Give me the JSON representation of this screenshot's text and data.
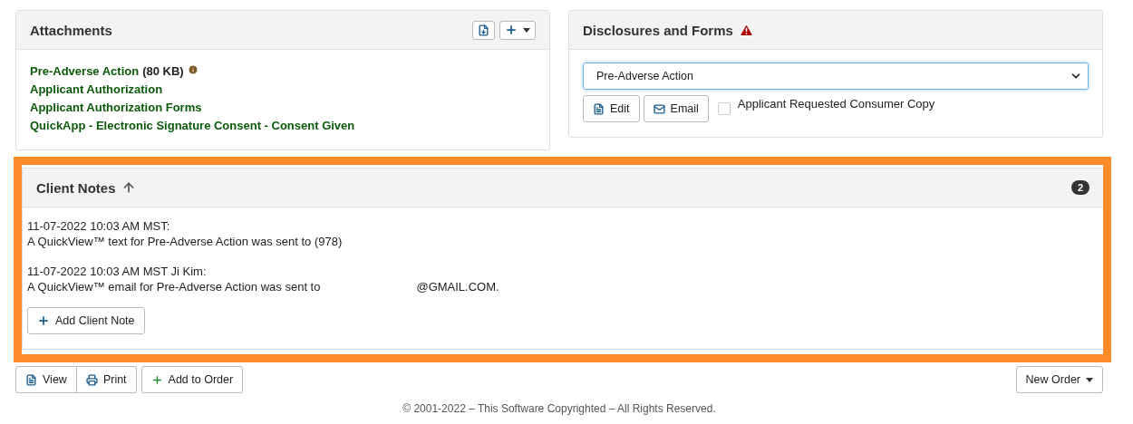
{
  "attachments": {
    "title": "Attachments",
    "items": [
      {
        "label": "Pre-Adverse Action",
        "size": "(80 KB)",
        "info": true
      },
      {
        "label": "Applicant Authorization",
        "info": false
      },
      {
        "label": "Applicant Authorization Forms",
        "info": false
      },
      {
        "label": "QuickApp - Electronic Signature Consent - Consent Given",
        "info": false
      }
    ]
  },
  "disclosures": {
    "title": "Disclosures and Forms",
    "warning": true,
    "select_value": "Pre-Adverse Action",
    "buttons": [
      {
        "kind": "edit",
        "label": "Edit"
      },
      {
        "kind": "email",
        "label": "Email"
      }
    ],
    "checkbox": {
      "label": "Applicant Requested Consumer Copy",
      "checked": false
    }
  },
  "client_notes": {
    "title": "Client Notes",
    "count": "2",
    "notes": [
      {
        "header": "11-07-2022 10:03 AM MST:",
        "body": "A QuickView™ text for Pre-Adverse Action was sent to (978)"
      },
      {
        "header": "11-07-2022 10:03 AM MST Ji Kim:",
        "body": "A QuickView™ email for Pre-Adverse Action was sent to",
        "tail": "@GMAIL.COM."
      }
    ],
    "add_button": "Add Client Note"
  },
  "actions": [
    {
      "kind": "view",
      "label": "View"
    },
    {
      "kind": "print",
      "label": "Print"
    },
    {
      "kind": "add",
      "label": "Add to Order"
    }
  ],
  "new_order": "New Order",
  "footer": "© 2001-2022 – This Software Copyrighted – All Rights Reserved."
}
